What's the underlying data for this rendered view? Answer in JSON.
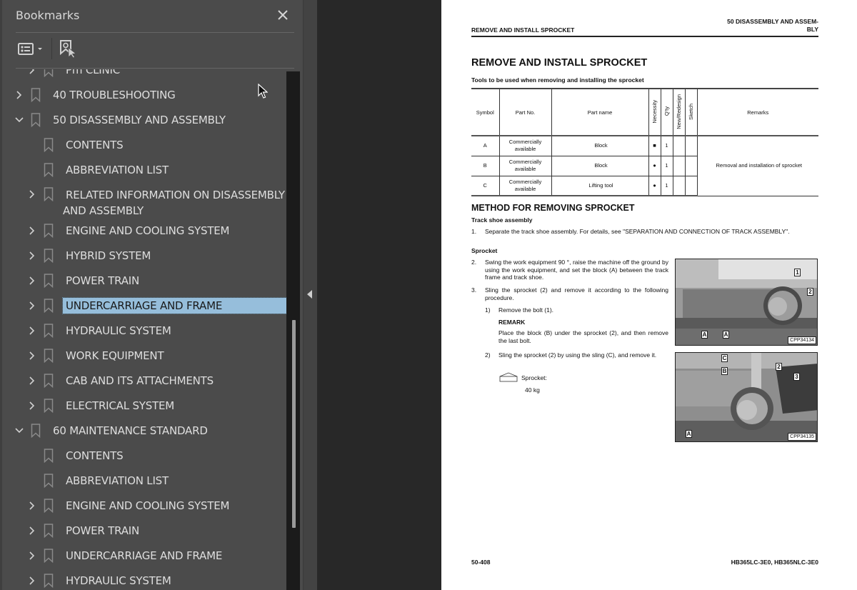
{
  "sidebar": {
    "title": "Bookmarks",
    "close_icon": "close-icon",
    "toolbar": {
      "options_icon": "bookmark-options-icon",
      "find_current_icon": "find-current-bookmark-icon"
    },
    "items": [
      {
        "label": "Pm CLINIC",
        "level": 1,
        "expandable": true,
        "expanded": false
      },
      {
        "label": "40 TROUBLESHOOTING",
        "level": 0,
        "expandable": true,
        "expanded": false
      },
      {
        "label": "50 DISASSEMBLY AND ASSEMBLY",
        "level": 0,
        "expandable": true,
        "expanded": true
      },
      {
        "label": "CONTENTS",
        "level": 1,
        "expandable": false
      },
      {
        "label": "ABBREVIATION LIST",
        "level": 1,
        "expandable": false
      },
      {
        "label": "RELATED INFORMATION ON DISASSEMBLY",
        "label_cont": "AND ASSEMBLY",
        "level": 1,
        "expandable": true,
        "expanded": false
      },
      {
        "label": "ENGINE AND COOLING SYSTEM",
        "level": 1,
        "expandable": true,
        "expanded": false
      },
      {
        "label": "HYBRID SYSTEM",
        "level": 1,
        "expandable": true,
        "expanded": false
      },
      {
        "label": "POWER TRAIN",
        "level": 1,
        "expandable": true,
        "expanded": false
      },
      {
        "label": "UNDERCARRIAGE AND FRAME",
        "level": 1,
        "expandable": true,
        "expanded": false,
        "selected": true
      },
      {
        "label": "HYDRAULIC SYSTEM",
        "level": 1,
        "expandable": true,
        "expanded": false
      },
      {
        "label": "WORK EQUIPMENT",
        "level": 1,
        "expandable": true,
        "expanded": false
      },
      {
        "label": "CAB AND ITS ATTACHMENTS",
        "level": 1,
        "expandable": true,
        "expanded": false
      },
      {
        "label": "ELECTRICAL SYSTEM",
        "level": 1,
        "expandable": true,
        "expanded": false
      },
      {
        "label": "60 MAINTENANCE STANDARD",
        "level": 0,
        "expandable": true,
        "expanded": true
      },
      {
        "label": "CONTENTS",
        "level": 1,
        "expandable": false
      },
      {
        "label": "ABBREVIATION LIST",
        "level": 1,
        "expandable": false
      },
      {
        "label": "ENGINE AND COOLING SYSTEM",
        "level": 1,
        "expandable": true,
        "expanded": false
      },
      {
        "label": "POWER TRAIN",
        "level": 1,
        "expandable": true,
        "expanded": false
      },
      {
        "label": "UNDERCARRIAGE AND FRAME",
        "level": 1,
        "expandable": true,
        "expanded": false
      },
      {
        "label": "HYDRAULIC SYSTEM",
        "level": 1,
        "expandable": true,
        "expanded": false
      }
    ],
    "scroll_position_fraction": 0.48,
    "scroll_visible_fraction": 0.4
  },
  "colors": {
    "sidebar_bg": "#4b4b4b",
    "canvas_bg": "#282828",
    "selection": "#96bedb",
    "text": "#dedede"
  },
  "page": {
    "header_left": "REMOVE AND INSTALL SPROCKET",
    "header_right_1": "50 DISASSEMBLY AND ASSEM-",
    "header_right_2": "BLY",
    "title": "REMOVE AND INSTALL SPROCKET",
    "subtitle": "Tools to be used when removing and installing the sprocket",
    "table": {
      "headers": [
        "Symbol",
        "Part No.",
        "Part name",
        "Necessity",
        "Q'ty",
        "New/Redesign",
        "Sketch",
        "Remarks"
      ],
      "rows": [
        {
          "symbol": "A",
          "part_no_1": "Commercially",
          "part_no_2": "available",
          "part_name": "Block",
          "necessity": "■",
          "qty": "1",
          "new": "",
          "sketch": ""
        },
        {
          "symbol": "B",
          "part_no_1": "Commercially",
          "part_no_2": "available",
          "part_name": "Block",
          "necessity": "●",
          "qty": "1",
          "new": "",
          "sketch": ""
        },
        {
          "symbol": "C",
          "part_no_1": "Commercially",
          "part_no_2": "available",
          "part_name": "Lifting tool",
          "necessity": "●",
          "qty": "1",
          "new": "",
          "sketch": ""
        }
      ],
      "remarks": "Removal and installation of sprocket"
    },
    "method_heading": "METHOD FOR REMOVING SPROCKET",
    "track_heading": "Track shoe assembly",
    "step1_num": "1.",
    "step1": "Separate the track shoe assembly. For details, see \"SEPARATION AND CONNECTION OF TRACK ASSEMBLY\".",
    "sprocket_heading": "Sprocket",
    "step2_num": "2.",
    "step2": "Swing the work equipment 90 °, raise the machine off the ground by using the work equipment, and set the block (A) between the track frame and track shoe.",
    "step3_num": "3.",
    "step3": "Sling the sprocket (2) and remove it according to the following procedure.",
    "sub1_num": "1)",
    "sub1": "Remove the bolt (1).",
    "remark_label": "REMARK",
    "remark": "Place the block (B) under the sprocket (2), and then remove the last bolt.",
    "sub2_num": "2)",
    "sub2": "Sling the sprocket (2) by using the sling (C), and remove it.",
    "weight_label": "Sprocket:",
    "weight_value": "40 kg",
    "figure1": {
      "id": "CPP34134",
      "callouts": [
        "1",
        "2",
        "A",
        "A"
      ]
    },
    "figure2": {
      "id": "CPP34135",
      "callouts": [
        "C",
        "B",
        "2",
        "3",
        "A"
      ]
    },
    "footer_left": "50-408",
    "footer_right": "HB365LC-3E0, HB365NLC-3E0"
  }
}
